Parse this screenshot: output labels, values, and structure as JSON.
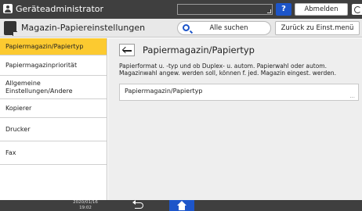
{
  "topbar": {
    "admin_label": "Geräteadministrator",
    "help_label": "?",
    "logout_label": "Abmelden"
  },
  "titlebar": {
    "title": "Magazin-Papiereinstellungen",
    "search_label": "Alle suchen",
    "back_menu_label": "Zurück zu Einst.menü"
  },
  "sidebar": {
    "items": [
      {
        "label": "Papiermagazin/Papiertyp"
      },
      {
        "label": "Papiermagazinpriorität"
      },
      {
        "label": "Allgemeine Einstellungen/Andere"
      },
      {
        "label": "Kopierer"
      },
      {
        "label": "Drucker"
      },
      {
        "label": "Fax"
      }
    ]
  },
  "main": {
    "section_title": "Papiermagazin/Papiertyp",
    "description": "Papierformat u. -typ und ob Duplex- u. autom. Papierwahl oder autom. Magazinwahl angew. werden soll, können f. jed. Magazin eingest. werden.",
    "setting_label": "Papiermagazin/Papiertyp",
    "setting_more": "..."
  },
  "bottombar": {
    "date": "2020/01/16",
    "time": "19:02"
  },
  "colors": {
    "header_bg": "#3f3f3f",
    "accent_blue": "#1d55c9",
    "active_item": "#fcca30"
  }
}
